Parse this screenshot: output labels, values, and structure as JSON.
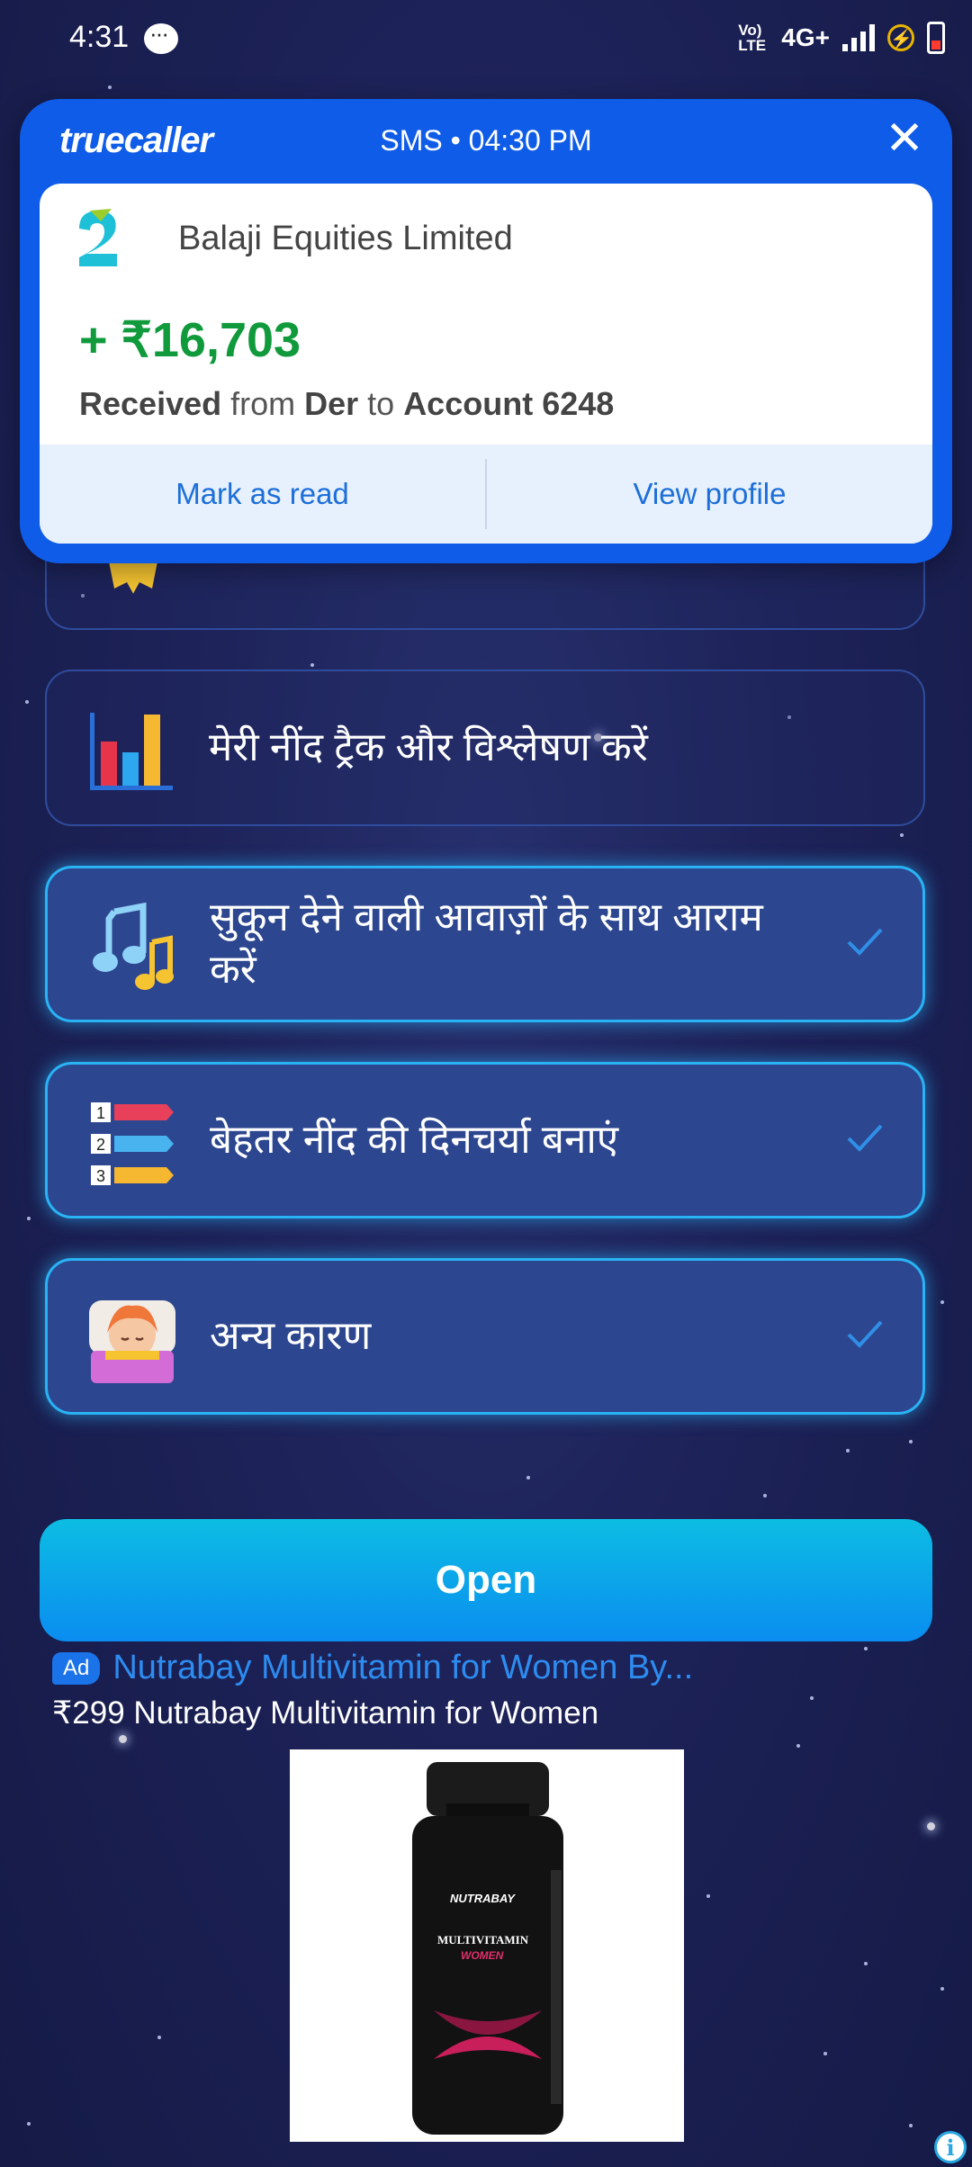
{
  "status_bar": {
    "time": "4:31",
    "network_label": "Vo) LTE",
    "network_type": "4G+",
    "icons": [
      "message-icon",
      "volte-icon",
      "signal-icon",
      "data-saver-icon",
      "battery-icon"
    ]
  },
  "notification": {
    "app": "truecaller",
    "meta": "SMS • 04:30 PM",
    "sender": "Balaji Equities Limited",
    "amount": "+ ₹16,703",
    "desc_word1": "Received",
    "desc_word2": " from ",
    "desc_word3": "Der",
    "desc_word4": " to ",
    "desc_word5": "Account 6248",
    "actions": [
      "Mark as read",
      "View profile"
    ],
    "colors": {
      "header": "#0f5ce8",
      "amount": "#109a3c",
      "action_text": "#1c6fd9"
    }
  },
  "options": [
    {
      "label": "मेरी नींद ट्रैक और विश्लेषण करें",
      "selected": false,
      "icon": "bar-chart-icon"
    },
    {
      "label": "सुकून देने वाली आवाज़ों के साथ आराम करें",
      "selected": true,
      "icon": "music-notes-icon"
    },
    {
      "label": "बेहतर नींद की दिनचर्या बनाएं",
      "selected": true,
      "icon": "numbered-list-icon"
    },
    {
      "label": "अन्य कारण",
      "selected": true,
      "icon": "sleeping-person-icon"
    }
  ],
  "open_button": "Open",
  "ad": {
    "badge": "Ad",
    "title": "Nutrabay Multivitamin for Women By...",
    "subtitle": "₹299 Nutrabay Multivitamin for Women",
    "product_brand": "NUTRABAY",
    "product_name": "MULTIVITAMIN",
    "product_variant": "WOMEN"
  }
}
